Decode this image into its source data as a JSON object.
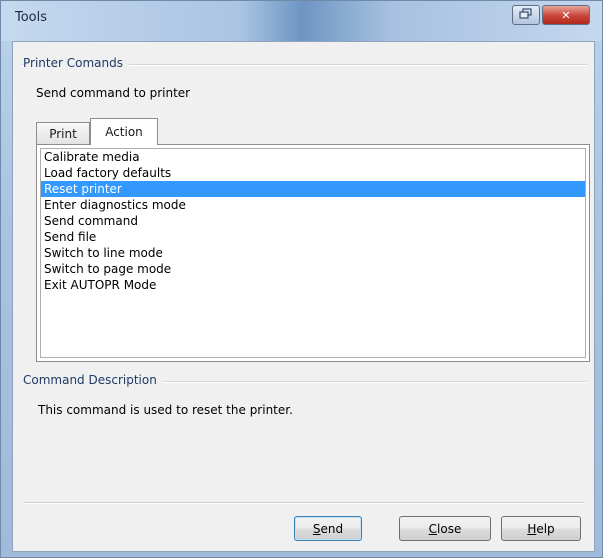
{
  "window": {
    "title": "Tools",
    "controls": {
      "restore_icon": "restore-icon",
      "close_glyph": "✕"
    }
  },
  "printer_commands": {
    "group_label": "Printer Comands",
    "instruction": "Send command to printer",
    "tabs": [
      {
        "label": "Print",
        "active": false
      },
      {
        "label": "Action",
        "active": true
      }
    ],
    "list_items": [
      {
        "label": "Calibrate media",
        "selected": false
      },
      {
        "label": "Load factory defaults",
        "selected": false
      },
      {
        "label": "Reset printer",
        "selected": true
      },
      {
        "label": "Enter diagnostics mode",
        "selected": false
      },
      {
        "label": "Send command",
        "selected": false
      },
      {
        "label": "Send file",
        "selected": false
      },
      {
        "label": "Switch to line mode",
        "selected": false
      },
      {
        "label": "Switch to page mode",
        "selected": false
      },
      {
        "label": "Exit AUTOPR Mode",
        "selected": false
      }
    ]
  },
  "command_description": {
    "group_label": "Command Description",
    "text": "This command is used to reset the printer."
  },
  "buttons": {
    "send": {
      "label_prefix": "",
      "accel": "S",
      "label_rest": "end"
    },
    "close": {
      "label_prefix": "",
      "accel": "C",
      "label_rest": "lose"
    },
    "help": {
      "label_prefix": "",
      "accel": "H",
      "label_rest": "elp"
    }
  },
  "colors": {
    "selection": "#3399ff",
    "group_label": "#1e3a66",
    "dialog_bg": "#f0f0f0"
  }
}
